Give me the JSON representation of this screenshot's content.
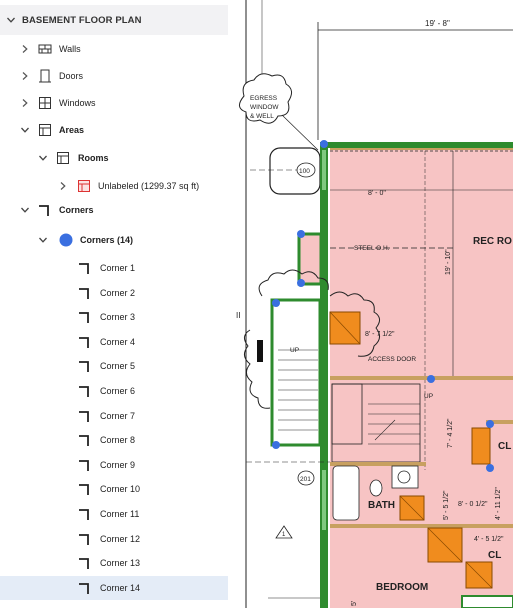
{
  "panel": {
    "title": "BASEMENT FLOOR PLAN",
    "items": [
      {
        "label": "Walls",
        "icon": "walls-icon",
        "expanded": false
      },
      {
        "label": "Doors",
        "icon": "door-icon",
        "expanded": false
      },
      {
        "label": "Windows",
        "icon": "window-icon",
        "expanded": false
      },
      {
        "label": "Areas",
        "icon": "area-icon",
        "expanded": true
      },
      {
        "label": "Rooms",
        "icon": "room-icon",
        "expanded": true
      },
      {
        "label": "Unlabeled (1299.37 sq ft)",
        "icon": "room-area-icon",
        "expanded": false
      },
      {
        "label": "Corners",
        "icon": "corner-icon",
        "expanded": true
      },
      {
        "label": "Corners (14)",
        "icon": "blue-dot-icon",
        "expanded": true
      }
    ],
    "corners": [
      "Corner 1",
      "Corner 2",
      "Corner 3",
      "Corner 4",
      "Corner 5",
      "Corner 6",
      "Corner 7",
      "Corner 8",
      "Corner 9",
      "Corner 10",
      "Corner 11",
      "Corner 12",
      "Corner 13",
      "Corner 14"
    ],
    "selected": "Corner 14"
  },
  "plan": {
    "dim_top": "19' - 8\"",
    "egress": [
      "EGRESS",
      "WINDOW",
      "& WELL"
    ],
    "tag_100": "100",
    "tag_201": "201",
    "tag_1": "1",
    "steel": "STEEL O.H.",
    "dim_8_0": "8' - 0\"",
    "rec_room": "REC RO",
    "dim_19_10": "19' - 10\"",
    "dim_8_7": "8' - 7 1/2\"",
    "access_door": "ACCESS DOOR",
    "up_left": "UP",
    "up_right": "UP",
    "dim_7_4": "7' - 4 1/2\"",
    "cl_right": "CL",
    "dim_4_11": "4' - 11 1/2\"",
    "bath": "BATH",
    "dim_5_5": "5' - 5 1/2\"",
    "dim_8_0h": "8' - 0 1/2\"",
    "dim_4_5": "4' - 5 1/2\"",
    "cl_bottom": "CL",
    "bedroom": "BEDROOM",
    "dim_5": "5'",
    "ii": "II"
  },
  "colors": {
    "room_fill": "#f7c4c4",
    "wall_green": "#2e8b2e",
    "corner_blue": "#3a6fe0",
    "door_orange": "#f08c1e",
    "selection": "#e4ecf7"
  }
}
